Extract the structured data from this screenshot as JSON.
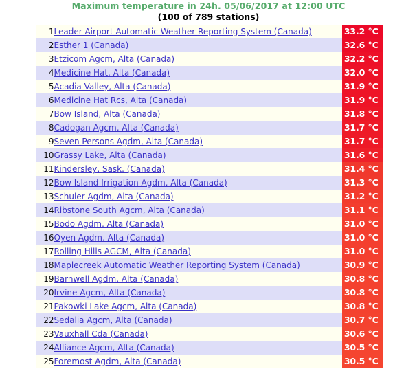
{
  "heading": {
    "title": "Maximum temperature in 24h. 05/06/2017 at 12:00 UTC",
    "subtitle": "(100 of 789 stations)"
  },
  "colors": {
    "title_green": "#56ab6b",
    "link_blue": "#3b32c8",
    "row_odd": "#fffff0",
    "row_even": "#dedef8",
    "badge_hot": "#ec0928",
    "badge_warm": "#f4402f",
    "page_background": "#ffffff"
  },
  "table": {
    "columns": [
      "rank",
      "station",
      "value"
    ],
    "rows": [
      {
        "rank": "1",
        "station": "Leader Airport Automatic Weather Reporting System (Canada)",
        "value": "33.2 °C",
        "badge_color": "#ec0928"
      },
      {
        "rank": "2",
        "station": "Esther 1 (Canada)",
        "value": "32.6 °C",
        "badge_color": "#ec0c28"
      },
      {
        "rank": "3",
        "station": "Etzicom Agcm, Alta (Canada)",
        "value": "32.2 °C",
        "badge_color": "#ed1028"
      },
      {
        "rank": "4",
        "station": "Medicine Hat, Alta (Canada)",
        "value": "32.0 °C",
        "badge_color": "#ed1228"
      },
      {
        "rank": "5",
        "station": "Acadia Valley, Alta (Canada)",
        "value": "31.9 °C",
        "badge_color": "#ee1427"
      },
      {
        "rank": "6",
        "station": "Medicine Hat Rcs, Alta (Canada)",
        "value": "31.9 °C",
        "badge_color": "#ee1427"
      },
      {
        "rank": "7",
        "station": "Bow Island, Alta (Canada)",
        "value": "31.8 °C",
        "badge_color": "#ee1727"
      },
      {
        "rank": "8",
        "station": "Cadogan Agcm, Alta (Canada)",
        "value": "31.7 °C",
        "badge_color": "#ee1a27"
      },
      {
        "rank": "9",
        "station": "Seven Persons Agdm, Alta (Canada)",
        "value": "31.7 °C",
        "badge_color": "#ee1a27"
      },
      {
        "rank": "10",
        "station": "Grassy Lake, Alta (Canada)",
        "value": "31.6 °C",
        "badge_color": "#ef2029"
      },
      {
        "rank": "11",
        "station": "Kindersley, Sask. (Canada)",
        "value": "31.4 °C",
        "badge_color": "#f0392d"
      },
      {
        "rank": "12",
        "station": "Bow Island Irrigation Agdm, Alta (Canada)",
        "value": "31.3 °C",
        "badge_color": "#f03a2d"
      },
      {
        "rank": "13",
        "station": "Schuler Agdm, Alta (Canada)",
        "value": "31.2 °C",
        "badge_color": "#f23b2d"
      },
      {
        "rank": "14",
        "station": "Ribstone South Agcm, Alta (Canada)",
        "value": "31.1 °C",
        "badge_color": "#f33d2e"
      },
      {
        "rank": "15",
        "station": "Bodo Agdm, Alta (Canada)",
        "value": "31.0 °C",
        "badge_color": "#f43f2f"
      },
      {
        "rank": "16",
        "station": "Oyen Agdm, Alta (Canada)",
        "value": "31.0 °C",
        "badge_color": "#f43f2f"
      },
      {
        "rank": "17",
        "station": "Rolling Hills AGCM, Alta (Canada)",
        "value": "31.0 °C",
        "badge_color": "#f43f2f"
      },
      {
        "rank": "18",
        "station": "Maplecreek Automatic Weather Reporting System (Canada)",
        "value": "30.9 °C",
        "badge_color": "#f4402f"
      },
      {
        "rank": "19",
        "station": "Barnwell Agdm, Alta (Canada)",
        "value": "30.8 °C",
        "badge_color": "#f4422f"
      },
      {
        "rank": "20",
        "station": "Irvine Agcm, Alta (Canada)",
        "value": "30.8 °C",
        "badge_color": "#f4422f"
      },
      {
        "rank": "21",
        "station": "Pakowki Lake Agcm, Alta (Canada)",
        "value": "30.8 °C",
        "badge_color": "#f4422f"
      },
      {
        "rank": "22",
        "station": "Sedalia Agcm, Alta (Canada)",
        "value": "30.7 °C",
        "badge_color": "#f4432f"
      },
      {
        "rank": "23",
        "station": "Vauxhall Cda (Canada)",
        "value": "30.6 °C",
        "badge_color": "#f44430"
      },
      {
        "rank": "24",
        "station": "Alliance Agcm, Alta (Canada)",
        "value": "30.5 °C",
        "badge_color": "#f54530"
      },
      {
        "rank": "25",
        "station": "Foremost Agdm, Alta (Canada)",
        "value": "30.5 °C",
        "badge_color": "#f54530"
      }
    ]
  }
}
